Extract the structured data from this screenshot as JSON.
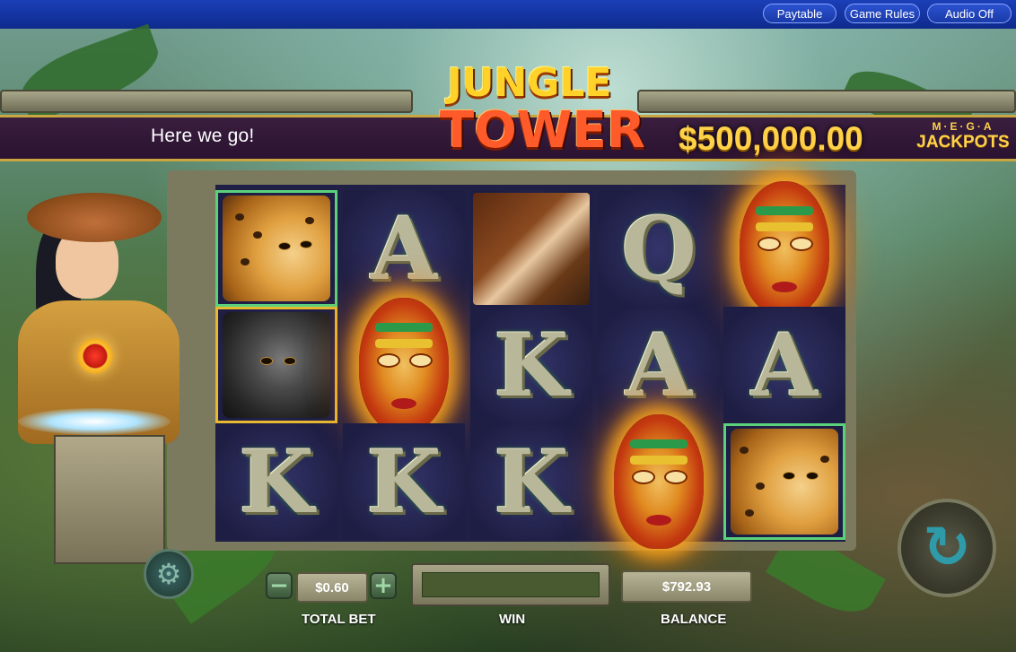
{
  "nav": {
    "paytable": "Paytable",
    "game_rules": "Game Rules",
    "audio": "Audio Off"
  },
  "header": {
    "message": "Here we go!",
    "jackpot": "$500,000.00",
    "mega_line1": "M·E·G·A",
    "mega_line2": "JACKPOTS"
  },
  "logo": {
    "line1": "JUNGLE",
    "line2": "TOWER"
  },
  "reels": [
    [
      "leopard",
      "gorilla",
      "K"
    ],
    [
      "A",
      "mask",
      "K"
    ],
    [
      "scroll",
      "K",
      "K"
    ],
    [
      "Q",
      "A",
      "mask"
    ],
    [
      "mask",
      "A",
      "leopard"
    ]
  ],
  "controls": {
    "total_bet_value": "$0.60",
    "total_bet_label": "TOTAL BET",
    "win_label": "WIN",
    "balance_value": "$792.93",
    "balance_label": "BALANCE",
    "minus": "−",
    "plus": "+"
  },
  "icons": [
    "settings-gear-icon",
    "spin-arrow-icon"
  ],
  "colors": {
    "nav_bg": "#1b3fb8",
    "banner_bg": "#2a1230",
    "jackpot": "#ffd24a",
    "highlight": "#5ad17a"
  }
}
